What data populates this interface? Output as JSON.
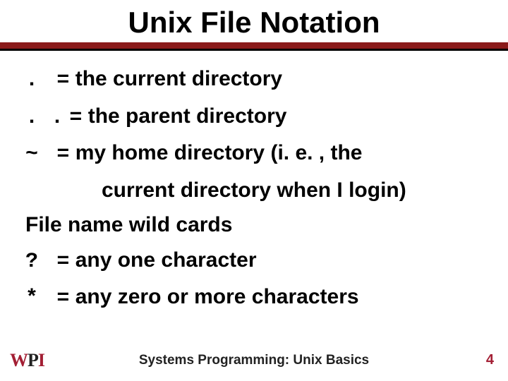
{
  "header": {
    "title": "Unix File Notation"
  },
  "lines": {
    "dot_sym": ".",
    "dot_eq": "=",
    "dot_desc": "the current directory",
    "dotdot_sym": ". .",
    "dotdot_eq": "=",
    "dotdot_desc": "the parent directory",
    "tilde_sym": "~",
    "tilde_eq": "=",
    "tilde_desc": "my home directory (i. e. , the",
    "tilde_cont": "current directory when I login)",
    "wild_header": "File name wild cards",
    "qmark_sym": "?",
    "qmark_eq": "=",
    "qmark_desc": "any one character",
    "star_sym": "*",
    "star_eq": "=",
    "star_desc": "any zero or more characters"
  },
  "footer": {
    "logo_w": "W",
    "logo_p": "P",
    "logo_i": "I",
    "caption": "Systems Programming:  Unix Basics",
    "pagenum": "4"
  }
}
